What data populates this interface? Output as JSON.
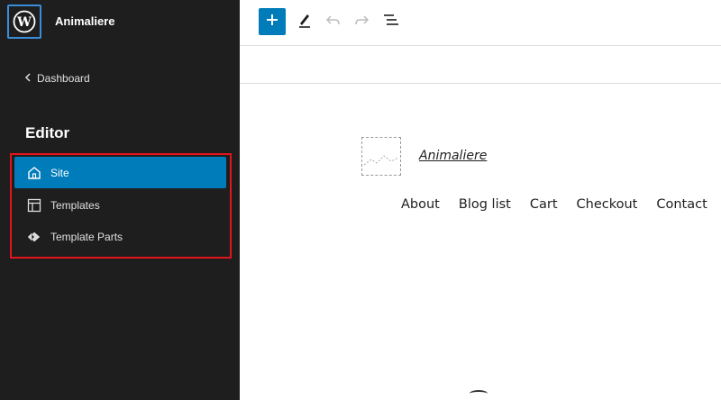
{
  "sidebar": {
    "site_name": "Animaliere",
    "back_label": "Dashboard",
    "section_title": "Editor",
    "items": [
      {
        "label": "Site",
        "icon": "home-icon",
        "active": true
      },
      {
        "label": "Templates",
        "icon": "layout-icon",
        "active": false
      },
      {
        "label": "Template Parts",
        "icon": "symbol-icon",
        "active": false
      }
    ],
    "highlight_color": "#e3141b"
  },
  "toolbar": {
    "add_icon": "plus-icon",
    "tools_icon": "pencil-icon",
    "undo_icon": "undo-icon",
    "redo_icon": "redo-icon",
    "list_view_icon": "list-view-icon"
  },
  "canvas": {
    "site_title": "Animaliere",
    "nav_links": [
      "About",
      "Blog list",
      "Cart",
      "Checkout",
      "Contact"
    ]
  },
  "colors": {
    "sidebar_bg": "#1e1e1e",
    "accent": "#007cba"
  }
}
